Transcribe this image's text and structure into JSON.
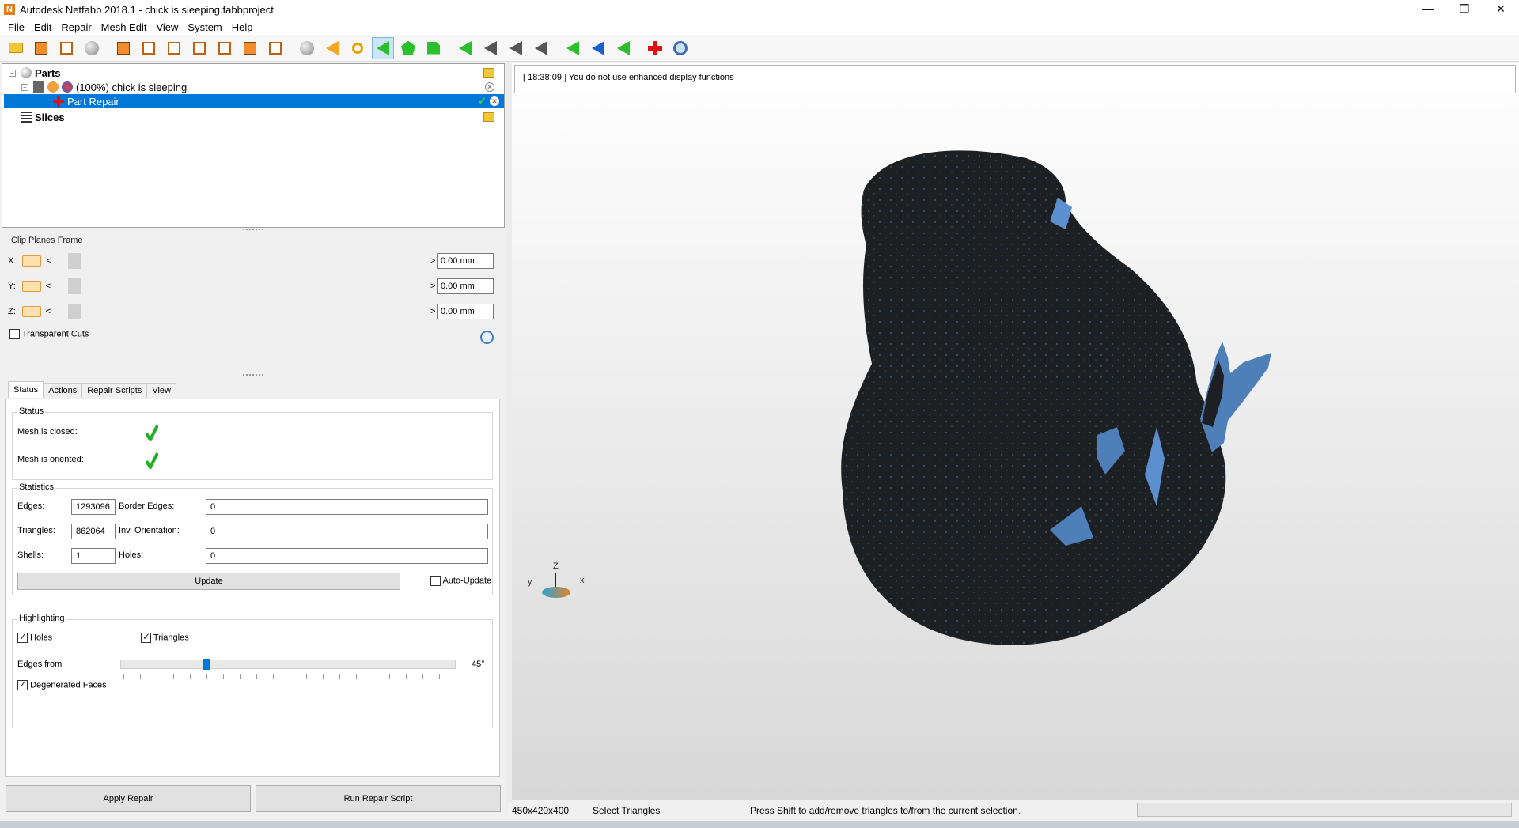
{
  "window": {
    "title": "Autodesk Netfabb 2018.1 - chick is sleeping.fabbproject",
    "app_icon_letter": "N",
    "controls": {
      "minimize": "—",
      "maximize": "❐",
      "close": "✕"
    }
  },
  "menu": [
    "File",
    "Edit",
    "Repair",
    "Mesh Edit",
    "View",
    "System",
    "Help"
  ],
  "toolbar": {
    "icons": [
      "open-project-icon",
      "add-part-icon",
      "add-part-from-file-icon",
      "new-part-icon",
      "view-front-icon",
      "view-back-icon",
      "view-left-icon",
      "view-right-icon",
      "view-top-icon",
      "view-bottom-icon",
      "view-iso-icon",
      "shade-sphere-icon",
      "previous-view-icon",
      "zoom-icon",
      "select-triangle-icon",
      "select-surface-icon",
      "select-shell-icon",
      "add-triangle-icon",
      "split-triangle-icon",
      "move-point-icon",
      "remove-triangle-icon",
      "undo-selection-icon",
      "invert-selection-icon",
      "select-all-icon",
      "repair-cross-icon",
      "settings-icon"
    ]
  },
  "tree": {
    "parts_label": "Parts",
    "part_label": "(100%) chick is sleeping",
    "repair_label": "Part Repair",
    "slices_label": "Slices"
  },
  "clip_planes": {
    "title": "Clip Planes Frame",
    "rows": [
      {
        "axis": "X:",
        "value": "0.00 mm"
      },
      {
        "axis": "Y:",
        "value": "0.00 mm"
      },
      {
        "axis": "Z:",
        "value": "0.00 mm"
      }
    ],
    "left_arrow": "<",
    "right_arrow": ">",
    "transparent_cuts": "Transparent Cuts"
  },
  "tabs": [
    "Status",
    "Actions",
    "Repair Scripts",
    "View"
  ],
  "status": {
    "group_title": "Status",
    "mesh_closed": "Mesh is closed:",
    "mesh_oriented": "Mesh is oriented:"
  },
  "statistics": {
    "group_title": "Statistics",
    "edges_label": "Edges:",
    "edges_value": "1293096",
    "border_edges_label": "Border Edges:",
    "border_edges_value": "0",
    "triangles_label": "Triangles:",
    "triangles_value": "862064",
    "inv_orientation_label": "Inv. Orientation:",
    "inv_orientation_value": "0",
    "shells_label": "Shells:",
    "shells_value": "1",
    "holes_label": "Holes:",
    "holes_value": "0",
    "update_button": "Update",
    "auto_update": "Auto-Update"
  },
  "highlighting": {
    "group_title": "Highlighting",
    "holes": "Holes",
    "triangles": "Triangles",
    "edges_from": "Edges from",
    "edges_value": "45°",
    "edges_slider_fraction": 0.25,
    "degenerated_faces": "Degenerated Faces"
  },
  "buttons": {
    "apply_repair": "Apply Repair",
    "run_repair_script": "Run Repair Script"
  },
  "log": {
    "message": "[ 18:38:09 ] You do not use enhanced display functions"
  },
  "statusbar": {
    "dimensions": "450x420x400",
    "mode": "Select Triangles",
    "hint": "Press Shift to add/remove triangles to/from the current selection."
  },
  "axes": {
    "z": "Z",
    "y": "y",
    "x": "x"
  },
  "colors": {
    "selection": "#0078d7",
    "mesh": "#1c1f22",
    "mesh_highlight": "#5b8fd0"
  }
}
